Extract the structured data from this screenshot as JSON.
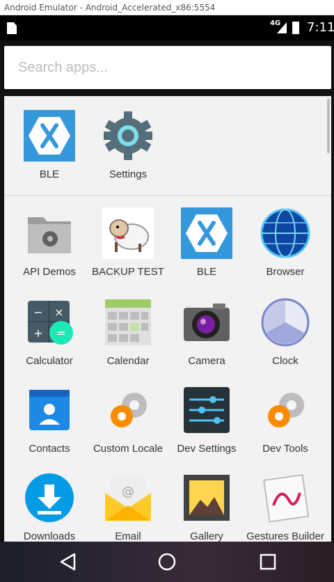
{
  "window": {
    "title": "Android Emulator - Android_Accelerated_x86:5554"
  },
  "status_bar": {
    "network": "4G",
    "time": "7:11"
  },
  "search": {
    "placeholder": "Search apps..."
  },
  "frequent_apps": [
    {
      "label": "BLE",
      "icon": "xamarin-icon"
    },
    {
      "label": "Settings",
      "icon": "gear-icon"
    }
  ],
  "apps": [
    {
      "label": "API Demos",
      "icon": "folder-gear-icon"
    },
    {
      "label": "BACKUP TEST",
      "icon": "sheep-icon"
    },
    {
      "label": "BLE",
      "icon": "xamarin-icon"
    },
    {
      "label": "Browser",
      "icon": "globe-icon"
    },
    {
      "label": "Calculator",
      "icon": "calculator-icon"
    },
    {
      "label": "Calendar",
      "icon": "calendar-icon"
    },
    {
      "label": "Camera",
      "icon": "camera-icon"
    },
    {
      "label": "Clock",
      "icon": "clock-icon"
    },
    {
      "label": "Contacts",
      "icon": "contacts-icon"
    },
    {
      "label": "Custom Locale",
      "icon": "custom-locale-gear-icon"
    },
    {
      "label": "Dev Settings",
      "icon": "sliders-icon"
    },
    {
      "label": "Dev Tools",
      "icon": "dev-tools-gear-icon"
    },
    {
      "label": "Downloads",
      "icon": "download-icon"
    },
    {
      "label": "Email",
      "icon": "email-icon"
    },
    {
      "label": "Gallery",
      "icon": "gallery-icon"
    },
    {
      "label": "Gestures Builder",
      "icon": "gestures-icon"
    }
  ],
  "nav": {
    "back": "back-icon",
    "home": "home-icon",
    "recents": "recents-icon"
  }
}
